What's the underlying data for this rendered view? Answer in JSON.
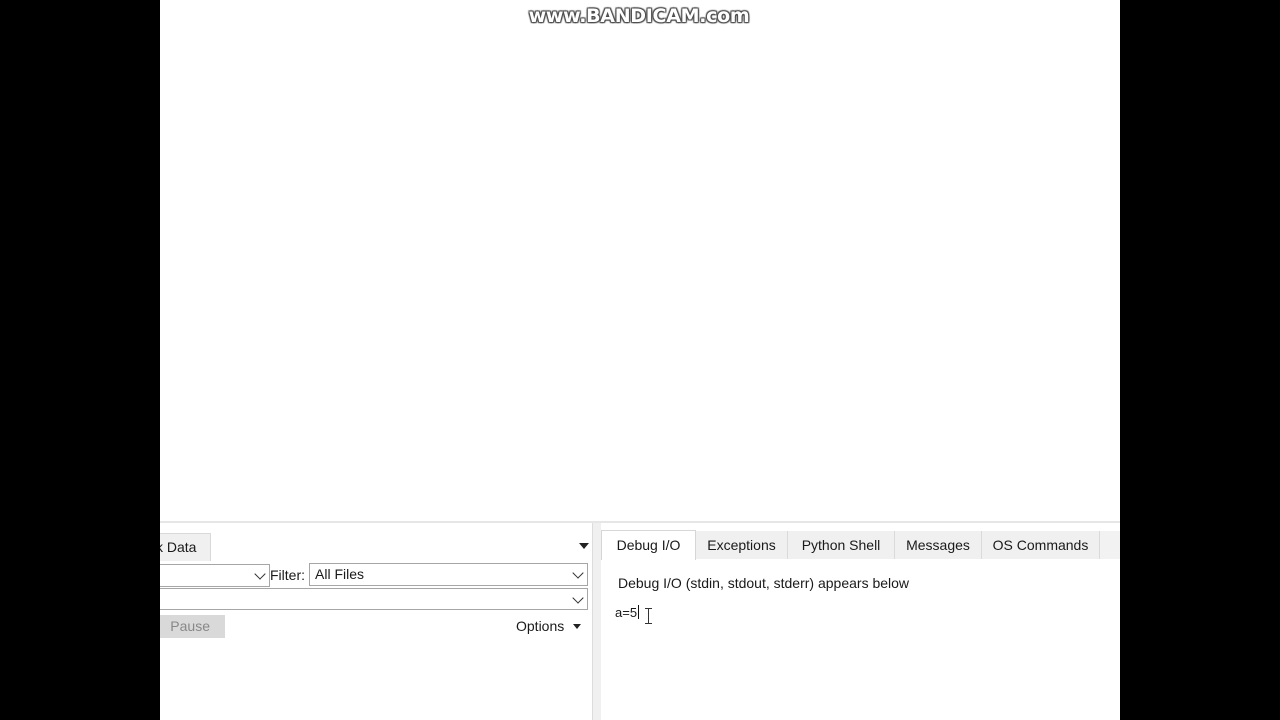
{
  "watermark": "www.BANDICAM.com",
  "left_panel": {
    "tab_label": "k Data",
    "search_value": "",
    "filter_label": "Filter:",
    "filter_value": "All Files",
    "path_value": "",
    "pause_label": "Pause",
    "options_label": "Options"
  },
  "right_panel": {
    "tabs": [
      {
        "label": "Debug I/O",
        "active": true
      },
      {
        "label": "Exceptions",
        "active": false
      },
      {
        "label": "Python Shell",
        "active": false
      },
      {
        "label": "Messages",
        "active": false
      },
      {
        "label": "OS Commands",
        "active": false
      }
    ],
    "header": "Debug I/O (stdin, stdout, stderr) appears below",
    "io_input": "a=5"
  },
  "colors": {
    "background": "#000000",
    "panel": "#ffffff",
    "tab_inactive": "#f0f0f0",
    "disabled_text": "#888888"
  }
}
